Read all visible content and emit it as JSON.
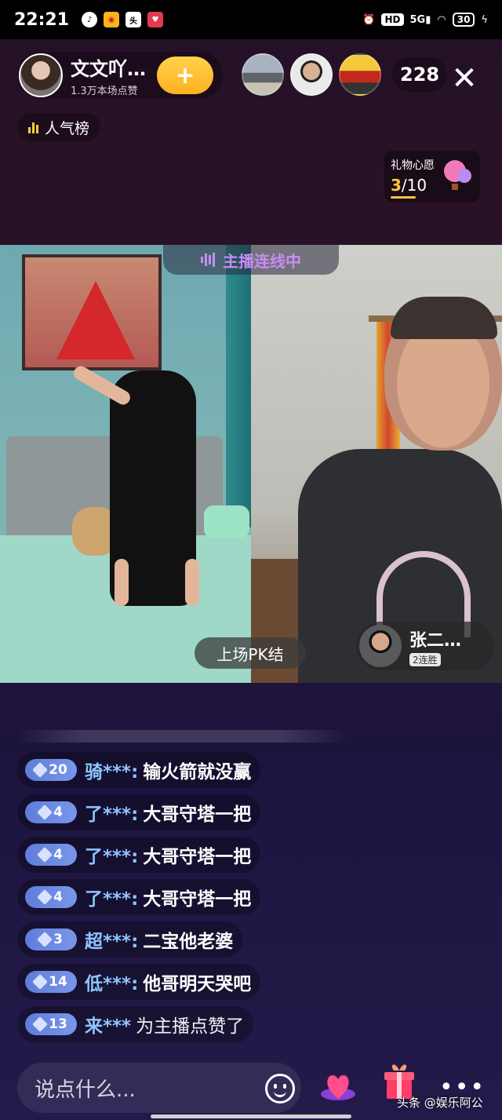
{
  "status_bar": {
    "time": "22:21",
    "apps": [
      "music-app",
      "weibo",
      "toutiao",
      "heart-app"
    ],
    "hd": "HD",
    "signal": "5G",
    "battery": "30"
  },
  "host": {
    "name": "文文吖…",
    "likes": "1.3万本场点赞",
    "follow_symbol": "+"
  },
  "viewers": {
    "count": "228"
  },
  "close_symbol": "✕",
  "ranking": {
    "label": "人气榜"
  },
  "gift_wish": {
    "title": "礼物心愿",
    "current": "3",
    "total": "/10"
  },
  "pk": {
    "tag": "主播连线中",
    "result_button": "上场PK结",
    "opponent": {
      "name": "张二…",
      "streak": "2连胜"
    }
  },
  "comments": [
    {
      "level": "20",
      "user": "骑***:",
      "text": "输火箭就没赢"
    },
    {
      "level": "4",
      "user": "了***:",
      "text": "大哥守塔一把"
    },
    {
      "level": "4",
      "user": "了***:",
      "text": "大哥守塔一把"
    },
    {
      "level": "4",
      "user": "了***:",
      "text": "大哥守塔一把"
    },
    {
      "level": "3",
      "user": "超***:",
      "text": "二宝他老婆"
    },
    {
      "level": "14",
      "user": "低***:",
      "text": "他哥明天哭吧"
    },
    {
      "level": "13",
      "user": "来***",
      "text": "为主播点赞了"
    }
  ],
  "input": {
    "placeholder": "说点什么..."
  },
  "more_symbol": "•••",
  "watermark": "头条 @娱乐阿公",
  "colors": {
    "accent_gold": "#ffc53d",
    "level_badge": "#6a88e2",
    "username": "#8ec5ff",
    "pk_purple": "#c98bf5"
  }
}
